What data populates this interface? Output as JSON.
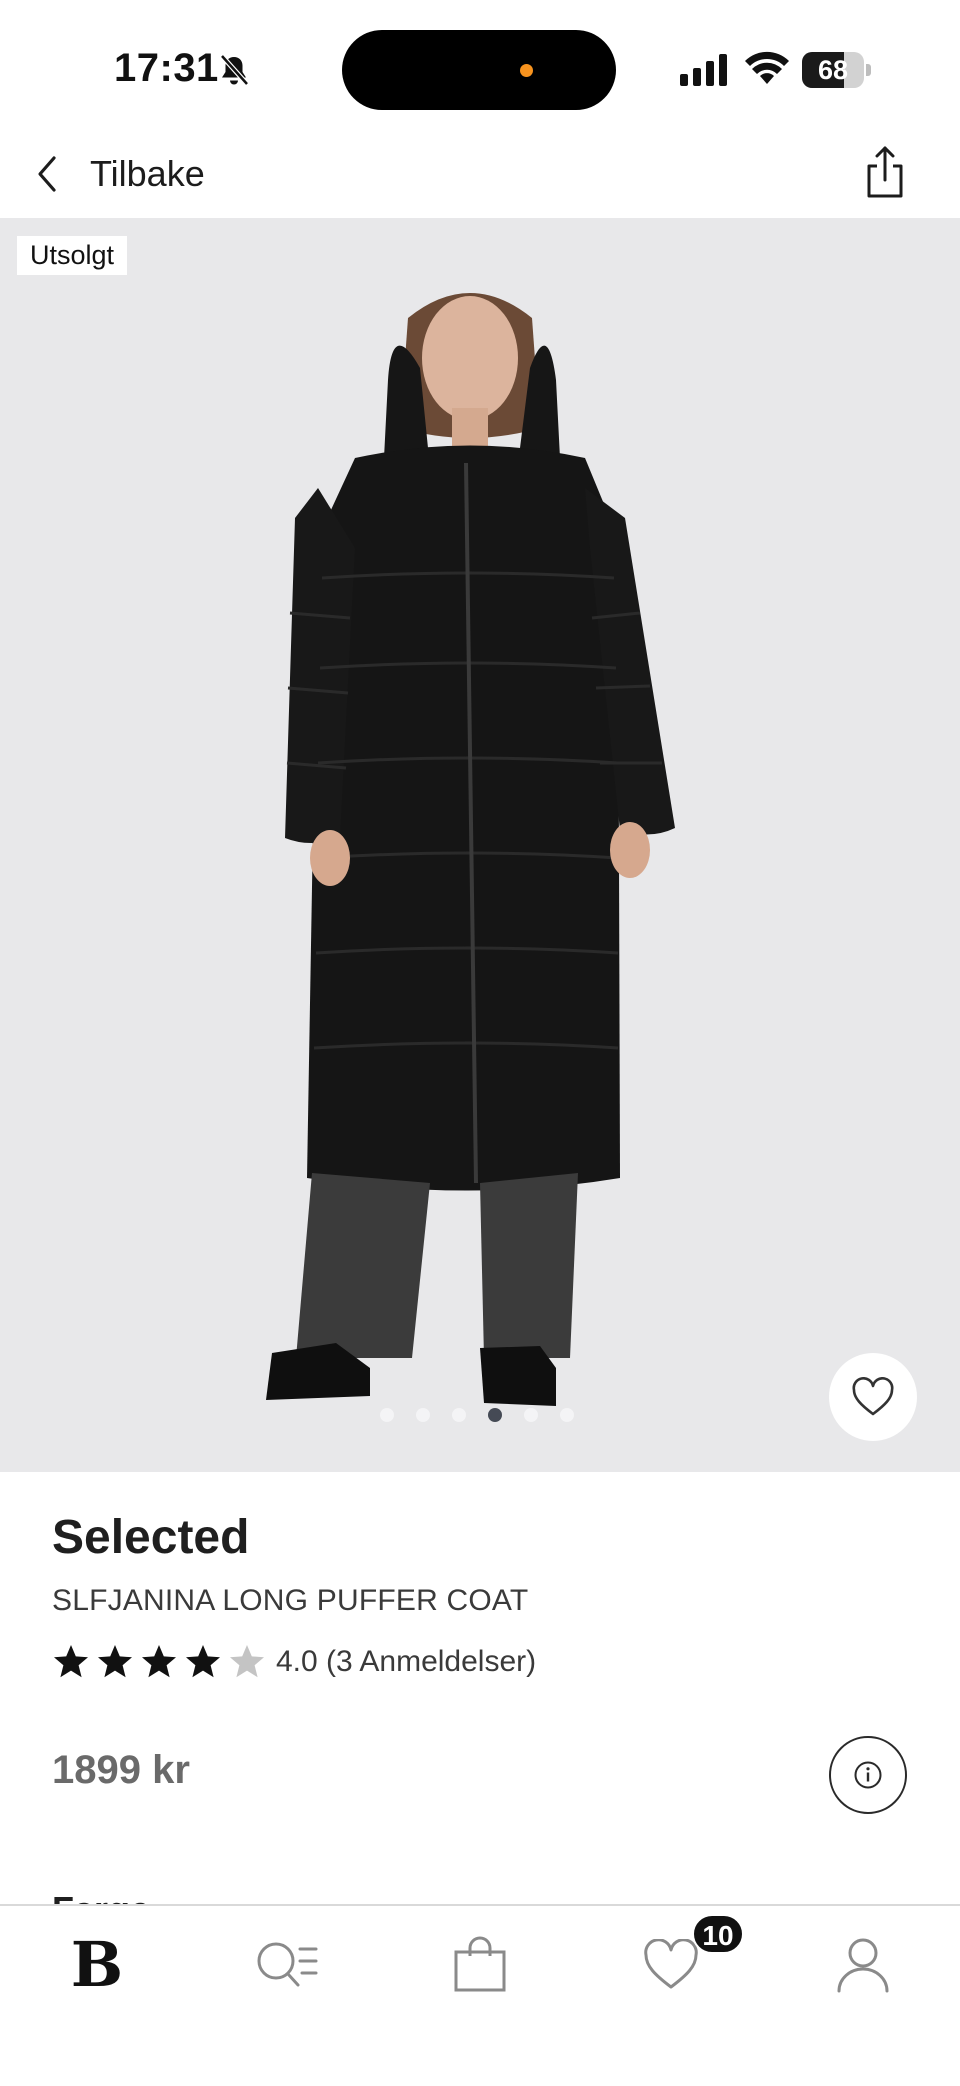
{
  "status_bar": {
    "time": "17:31",
    "battery_percent": "68",
    "battery_level": 0.68
  },
  "nav": {
    "back_label": "Tilbake"
  },
  "product": {
    "badge": "Utsolgt",
    "brand": "Selected",
    "name": "SLFJANINA LONG PUFFER COAT",
    "rating_value": 4.0,
    "rating_text": "4.0 (3 Anmeldelser)",
    "stars_filled": 4,
    "stars_total": 5,
    "price": "1899 kr",
    "image_count": 6,
    "active_image_index": 3,
    "color_section_label": "Farge"
  },
  "tab_bar": {
    "home_logo": "B",
    "favorites_count": "10",
    "icons": [
      "home-logo",
      "search-list-icon",
      "shopping-bag-icon",
      "heart-icon",
      "person-icon"
    ]
  },
  "colors": {
    "image_background": "#e8e8ea",
    "coat": "#151515",
    "island_indicator": "#f7931e",
    "active_dot": "#454a55"
  }
}
